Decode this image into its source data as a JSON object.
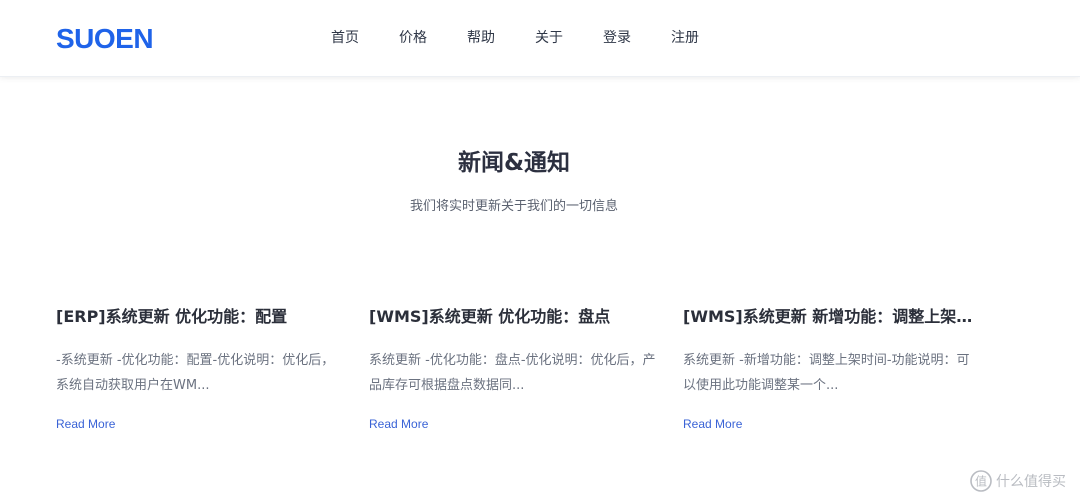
{
  "header": {
    "logo": "SUOEN",
    "nav": [
      {
        "label": "首页",
        "name": "nav-home"
      },
      {
        "label": "价格",
        "name": "nav-pricing"
      },
      {
        "label": "帮助",
        "name": "nav-help"
      },
      {
        "label": "关于",
        "name": "nav-about"
      },
      {
        "label": "登录",
        "name": "nav-login"
      },
      {
        "label": "注册",
        "name": "nav-register"
      }
    ]
  },
  "news": {
    "title": "新闻&通知",
    "subtitle": "我们将实时更新关于我们的一切信息",
    "cards": [
      {
        "title": "[ERP]系统更新 优化功能：配置",
        "desc": "-系统更新 -优化功能：配置-优化说明：优化后，系统自动获取用户在WM...",
        "link": "Read More"
      },
      {
        "title": "[WMS]系统更新 优化功能：盘点",
        "desc": "系统更新 -优化功能：盘点-优化说明：优化后，产品库存可根据盘点数据同...",
        "link": "Read More"
      },
      {
        "title": "[WMS]系统更新 新增功能：调整上架...",
        "desc": "系统更新 -新增功能：调整上架时间-功能说明：可以使用此功能调整某一个...",
        "link": "Read More"
      }
    ]
  },
  "watermark": {
    "text": "什么值得买",
    "icon": "zhi-icon"
  },
  "colors": {
    "brand": "#1f63e9",
    "link": "#3a63d6",
    "title": "#2c3040"
  }
}
